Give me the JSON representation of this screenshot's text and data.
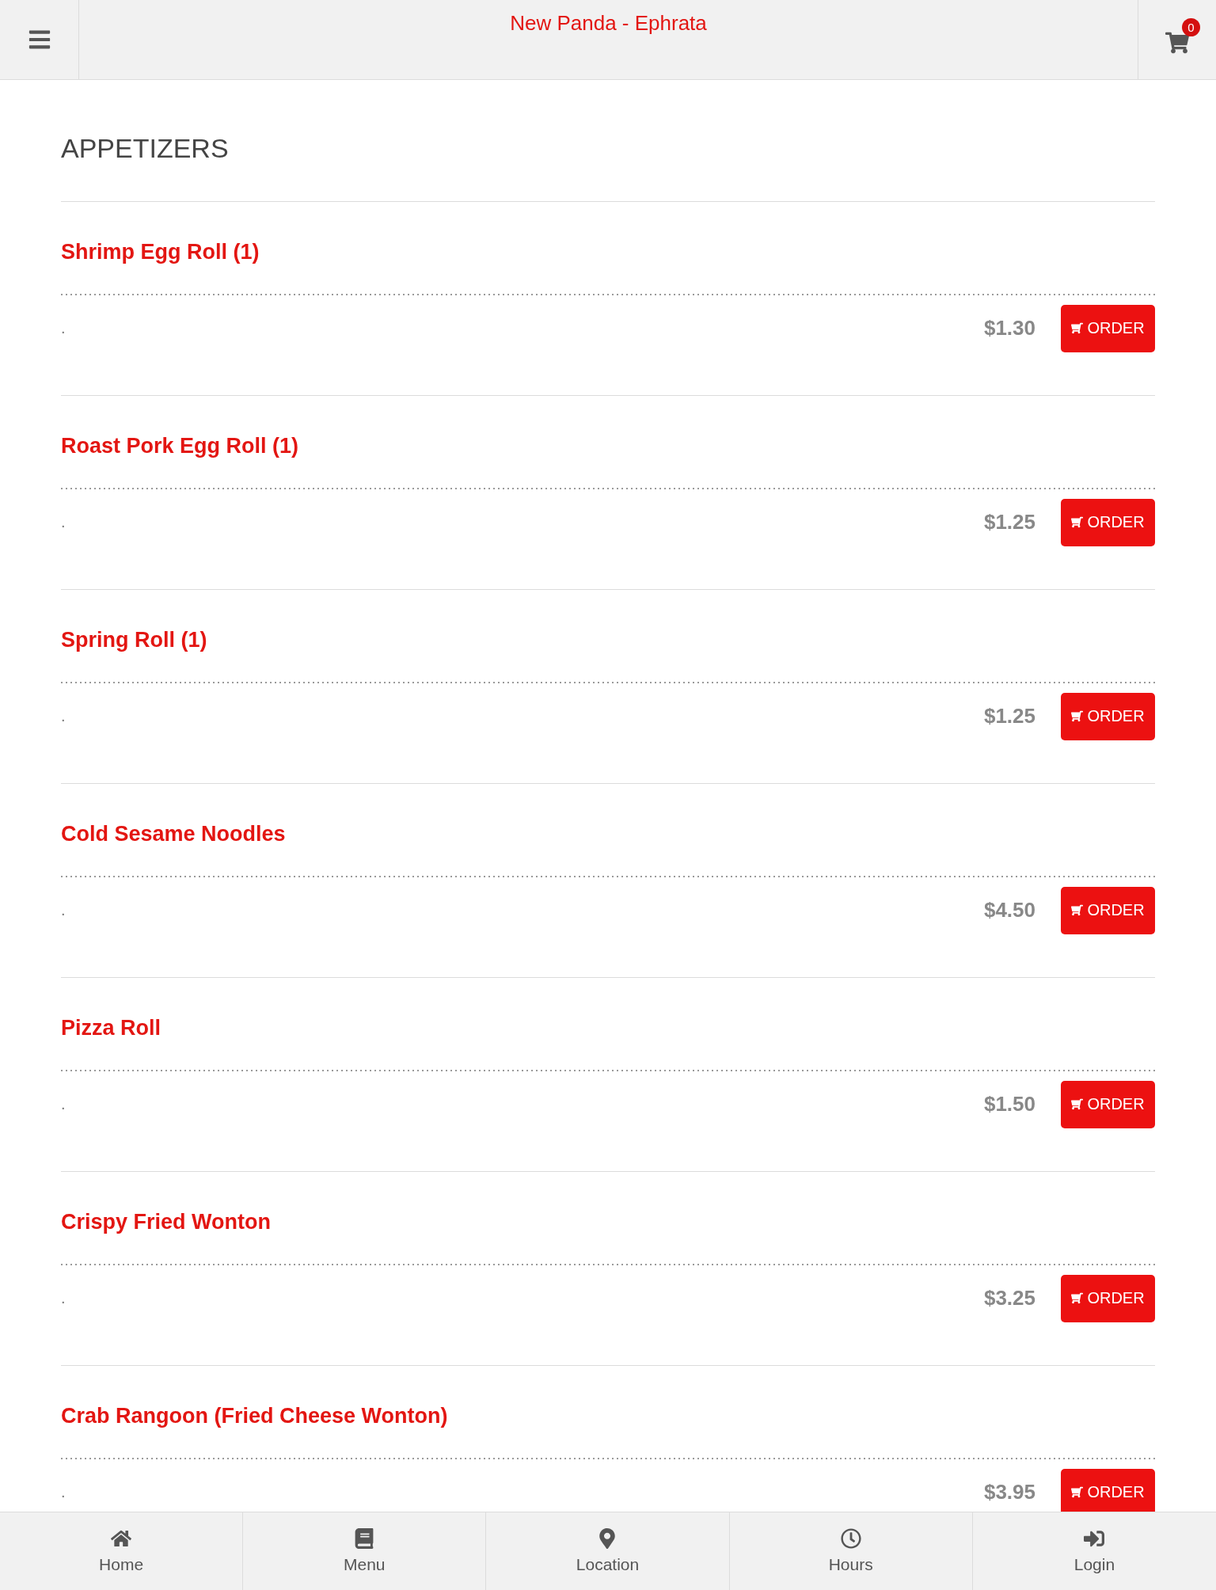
{
  "header": {
    "title": "New Panda - Ephrata",
    "cart_count": "0"
  },
  "section": {
    "title": "APPETIZERS"
  },
  "items": [
    {
      "name": "Shrimp Egg Roll (1)",
      "description": ".",
      "price": "$1.30",
      "button": "ORDER"
    },
    {
      "name": "Roast Pork Egg Roll (1)",
      "description": ".",
      "price": "$1.25",
      "button": "ORDER"
    },
    {
      "name": "Spring Roll (1)",
      "description": ".",
      "price": "$1.25",
      "button": "ORDER"
    },
    {
      "name": "Cold Sesame Noodles",
      "description": ".",
      "price": "$4.50",
      "button": "ORDER"
    },
    {
      "name": "Pizza Roll",
      "description": ".",
      "price": "$1.50",
      "button": "ORDER"
    },
    {
      "name": "Crispy Fried Wonton",
      "description": ".",
      "price": "$3.25",
      "button": "ORDER"
    },
    {
      "name": "Crab Rangoon (Fried Cheese Wonton)",
      "description": ".",
      "price": "$3.95",
      "button": "ORDER"
    }
  ],
  "bottom_nav": [
    {
      "label": "Home",
      "selected": false
    },
    {
      "label": "Menu",
      "selected": false
    },
    {
      "label": "Location",
      "selected": false
    },
    {
      "label": "Hours",
      "selected": false
    },
    {
      "label": "Login",
      "selected": false
    }
  ]
}
